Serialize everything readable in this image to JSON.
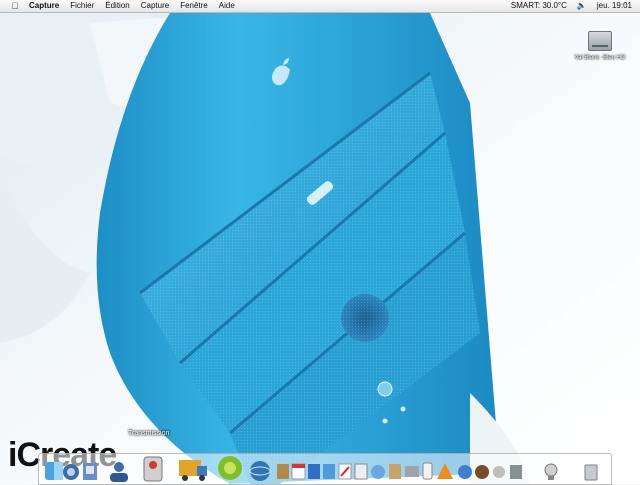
{
  "menubar": {
    "apple_icon": "apple-menu-icon",
    "menus": [
      "Capture",
      "Fichier",
      "Édition",
      "Capture",
      "Fenêtre",
      "Aide"
    ],
    "smart": "SMART: 30.0°C",
    "volume_icon": "speaker-icon",
    "clock": "jeu. 19:01"
  },
  "desktop": {
    "drive_label": "Val Blanc -Bleu HD",
    "brand_text": "iCreate"
  },
  "dock": {
    "hover_label": "Transmission",
    "items": [
      {
        "name": "finder-icon"
      },
      {
        "name": "dashboard-icon"
      },
      {
        "name": "preview-icon"
      },
      {
        "name": "user-icon"
      },
      {
        "name": "transmission-icon"
      },
      {
        "name": "delivery-truck-icon"
      },
      {
        "name": "ball-icon"
      },
      {
        "name": "globe-icon"
      },
      {
        "name": "notebook-icon"
      },
      {
        "name": "ical-icon"
      },
      {
        "name": "word-icon"
      },
      {
        "name": "preferences-icon"
      },
      {
        "name": "acrobat-icon"
      },
      {
        "name": "textedit-icon"
      },
      {
        "name": "itunes-icon"
      },
      {
        "name": "address-book-icon"
      },
      {
        "name": "printer-icon"
      },
      {
        "name": "ipod-icon"
      },
      {
        "name": "vlc-icon"
      },
      {
        "name": "safari-icon"
      },
      {
        "name": "photo-icon"
      },
      {
        "name": "apple-icon"
      },
      {
        "name": "utility-icon"
      },
      {
        "name": "webcam-icon"
      },
      {
        "name": "trash-icon"
      }
    ]
  },
  "colors": {
    "accent_blue": "#2aa6d9",
    "menubar": "#eeeeee"
  }
}
